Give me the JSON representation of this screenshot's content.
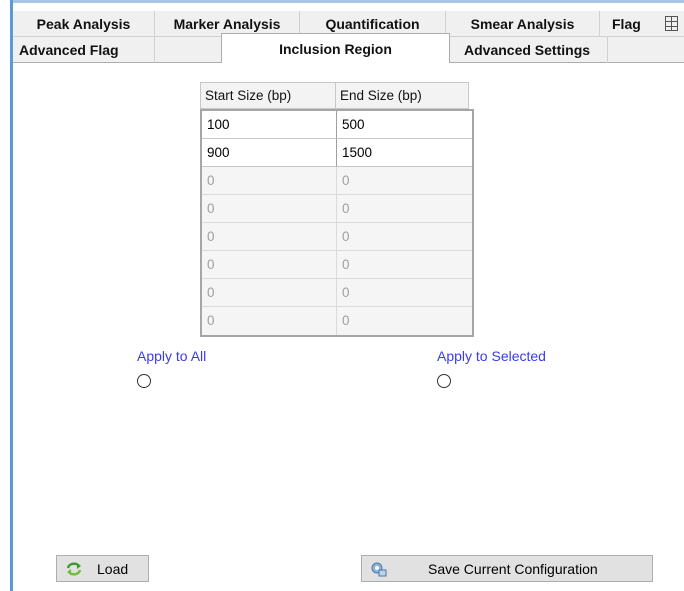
{
  "tabs": {
    "row1": [
      {
        "label": "Peak Analysis"
      },
      {
        "label": "Marker Analysis"
      },
      {
        "label": "Quantification"
      },
      {
        "label": "Smear Analysis"
      },
      {
        "label": "Flag"
      }
    ],
    "row2": [
      {
        "label": "Advanced Flag"
      },
      {
        "label": "Inclusion Region",
        "active": true
      },
      {
        "label": "Advanced Settings"
      }
    ]
  },
  "grid": {
    "columns": [
      "Start Size (bp)",
      "End Size (bp)"
    ],
    "rows": [
      [
        "100",
        "500"
      ],
      [
        "900",
        "1500"
      ],
      [
        "0",
        "0"
      ],
      [
        "0",
        "0"
      ],
      [
        "0",
        "0"
      ],
      [
        "0",
        "0"
      ],
      [
        "0",
        "0"
      ],
      [
        "0",
        "0"
      ]
    ]
  },
  "options": {
    "apply_all": "Apply to All",
    "apply_selected": "Apply to Selected"
  },
  "buttons": {
    "load": "Load",
    "save": "Save Current Configuration"
  },
  "icons": {
    "load": "refresh-arrows-icon",
    "save": "save-config-icon",
    "tab_overflow": "grid-icon"
  },
  "colors": {
    "link_text": "#3a3af0",
    "accent_edge": "#5b9bd5"
  }
}
